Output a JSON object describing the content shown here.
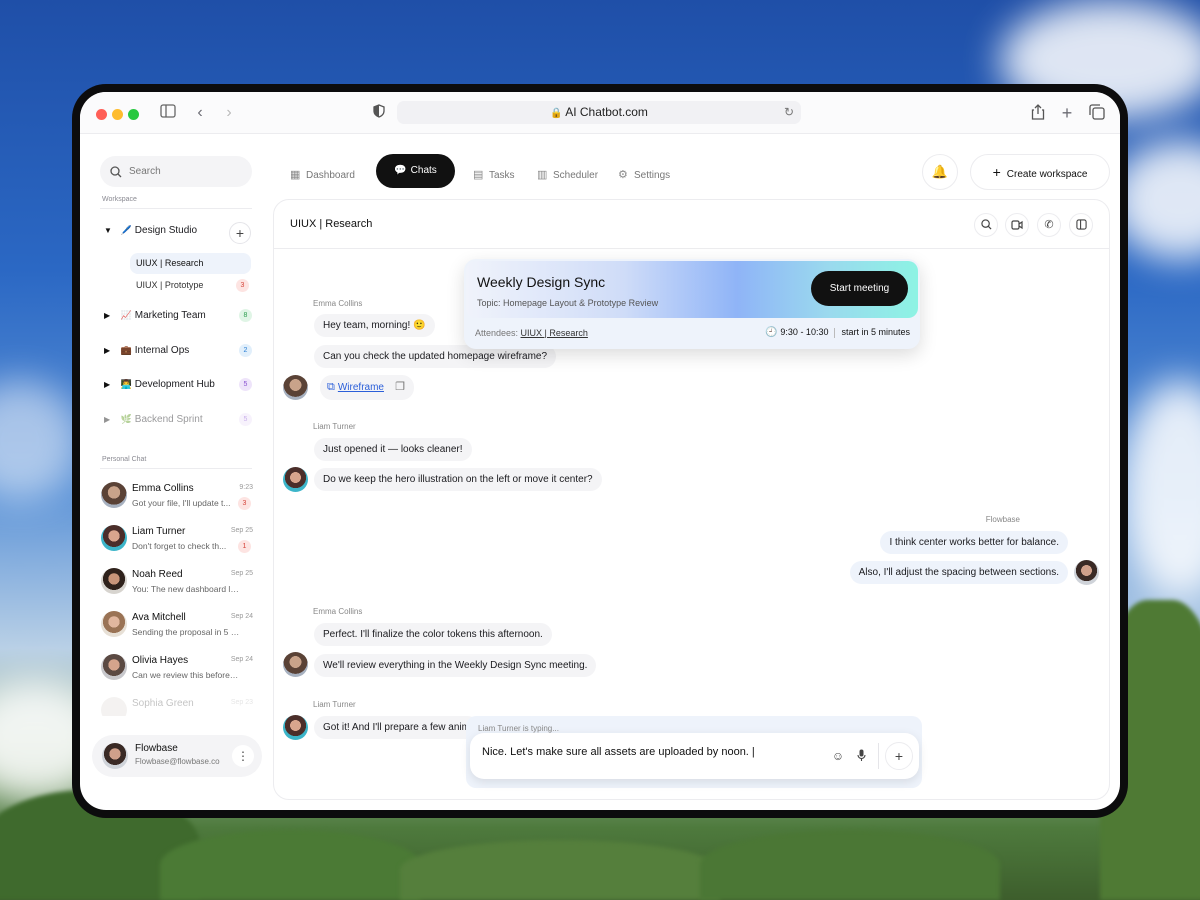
{
  "browser": {
    "url": "AI Chatbot.com"
  },
  "sidebar": {
    "search_placeholder": "Search",
    "workspace_label": "Workspace",
    "workspaces": [
      {
        "emoji": "🖊️",
        "label": "Design Studio",
        "count": ""
      },
      {
        "emoji": "📈",
        "label": "Marketing Team",
        "count": "8"
      },
      {
        "emoji": "💼",
        "label": "Internal Ops",
        "count": "2"
      },
      {
        "emoji": "👨‍💻",
        "label": "Development Hub",
        "count": "5"
      },
      {
        "emoji": "🌿",
        "label": "Backend Sprint",
        "count": "5"
      }
    ],
    "subitems": [
      {
        "label": "UIUX | Research",
        "count": ""
      },
      {
        "label": "UIUX | Prototype",
        "count": "3"
      }
    ],
    "personal_label": "Personal Chat",
    "chats": [
      {
        "name": "Emma Collins",
        "time": "9:23",
        "preview": "Got your file, I'll update t...",
        "count": "3"
      },
      {
        "name": "Liam Turner",
        "time": "Sep 25",
        "preview": "Don't forget to check th...",
        "count": "1"
      },
      {
        "name": "Noah Reed",
        "time": "Sep 25",
        "preview": "You: The new dashboard loo...",
        "count": ""
      },
      {
        "name": "Ava Mitchell",
        "time": "Sep 24",
        "preview": "Sending the proposal in 5 mi...",
        "count": ""
      },
      {
        "name": "Olivia Hayes",
        "time": "Sep 24",
        "preview": "Can we review this before th...",
        "count": ""
      },
      {
        "name": "Sophia Green",
        "time": "Sep 23",
        "preview": "",
        "count": ""
      }
    ],
    "profile": {
      "name": "Flowbase",
      "email": "Flowbase@flowbase.co"
    }
  },
  "nav": {
    "items": [
      "Dashboard",
      "Chats",
      "Tasks",
      "Scheduler",
      "Settings"
    ],
    "create_workspace": "Create workspace"
  },
  "chat": {
    "title": "UIUX | Research",
    "messages": [
      {
        "sender": "Emma Collins",
        "texts": [
          "Hey team, morning! 🙂",
          "Can you check the updated homepage wireframe?"
        ]
      },
      {
        "sender": "Liam Turner",
        "texts": [
          "Just opened it — looks cleaner!",
          "Do we keep the hero illustration on the left or move it center?"
        ]
      },
      {
        "sender": "Flowbase",
        "texts": [
          "I think center works better for balance.",
          "Also, I'll adjust the spacing between sections."
        ]
      },
      {
        "sender": "Emma Collins",
        "texts": [
          "Perfect. I'll finalize the color tokens this afternoon.",
          "We'll review everything in the Weekly Design Sync meeting."
        ]
      },
      {
        "sender": "Liam Turner",
        "texts": [
          "Got it! And I'll prepare a few anim"
        ]
      }
    ],
    "file_label": "Wireframe"
  },
  "meeting": {
    "title": "Weekly Design Sync",
    "topic": "Topic: Homepage Layout & Prototype Review",
    "start_label": "Start meeting",
    "attendees_label": "Attendees:",
    "attendees_value": "UIUX | Research",
    "time": "9:30 - 10:30",
    "starts_in": "start in 5 minutes"
  },
  "composer": {
    "typing": "Liam Turner is typing...",
    "value": "Nice. Let's make sure all assets are uploaded by noon. |"
  },
  "colors": {
    "accent": "#111111",
    "link": "#2b5fd9",
    "badge_red": "#d5453b",
    "badge_green": "#2e9e4f",
    "badge_blue": "#2a7fd4",
    "badge_purple": "#8a52d1"
  }
}
